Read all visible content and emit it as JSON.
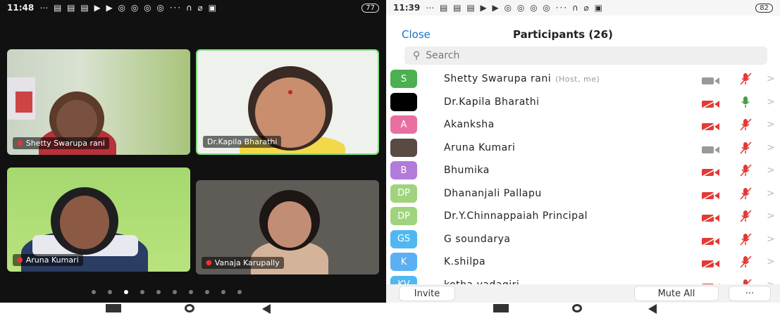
{
  "left": {
    "status": {
      "time": "11:48",
      "icons": "⋯ ▤ ▤ ▤ ▶ ▶ ◎ ◎ ◎ ◎ ··· ∩ ⌀ ▣",
      "battery": "77"
    },
    "tiles": [
      {
        "name": "Shetty Swarupa rani",
        "muted": true
      },
      {
        "name": "Dr.Kapila Bharathi",
        "muted": false
      },
      {
        "name": "Aruna Kumari",
        "muted": true
      },
      {
        "name": "Vanaja Karupally",
        "muted": true
      }
    ]
  },
  "right": {
    "status": {
      "time": "11:39",
      "icons": "⋯ ▤ ▤ ▤ ▶ ▶ ◎ ◎ ◎ ◎ ··· ∩ ⌀ ▣",
      "battery": "82"
    },
    "close_label": "Close",
    "title": "Participants (26)",
    "search_placeholder": "Search",
    "participants": [
      {
        "initials": "S",
        "color": "#4caf50",
        "name": "Shetty Swarupa rani",
        "tag": "(Host, me)",
        "cam": "gray",
        "mic": "red"
      },
      {
        "initials": "",
        "color": "#000000",
        "name": "Dr.Kapila Bharathi",
        "tag": "",
        "cam": "red",
        "mic": "green"
      },
      {
        "initials": "A",
        "color": "#e96fa0",
        "name": "Akanksha",
        "tag": "",
        "cam": "red",
        "mic": "red"
      },
      {
        "initials": "",
        "color": "#5a4a44",
        "name": "Aruna Kumari",
        "tag": "",
        "cam": "gray",
        "mic": "red"
      },
      {
        "initials": "B",
        "color": "#b27ad9",
        "name": "Bhumika",
        "tag": "",
        "cam": "red",
        "mic": "red"
      },
      {
        "initials": "DP",
        "color": "#9fd47d",
        "name": "Dhananjali Pallapu",
        "tag": "",
        "cam": "red",
        "mic": "red"
      },
      {
        "initials": "DP",
        "color": "#9fd47d",
        "name": "Dr.Y.Chinnappaiah Principal",
        "tag": "",
        "cam": "red",
        "mic": "red"
      },
      {
        "initials": "GS",
        "color": "#4fb8f0",
        "name": "G soundarya",
        "tag": "",
        "cam": "red",
        "mic": "red"
      },
      {
        "initials": "K",
        "color": "#5ab0f2",
        "name": "K.shilpa",
        "tag": "",
        "cam": "red",
        "mic": "red"
      },
      {
        "initials": "KV",
        "color": "#4fb8f0",
        "name": "kotha vadagiri",
        "tag": "",
        "cam": "red",
        "mic": "red"
      }
    ],
    "invite_label": "Invite",
    "mute_all_label": "Mute All",
    "more_label": "···"
  }
}
